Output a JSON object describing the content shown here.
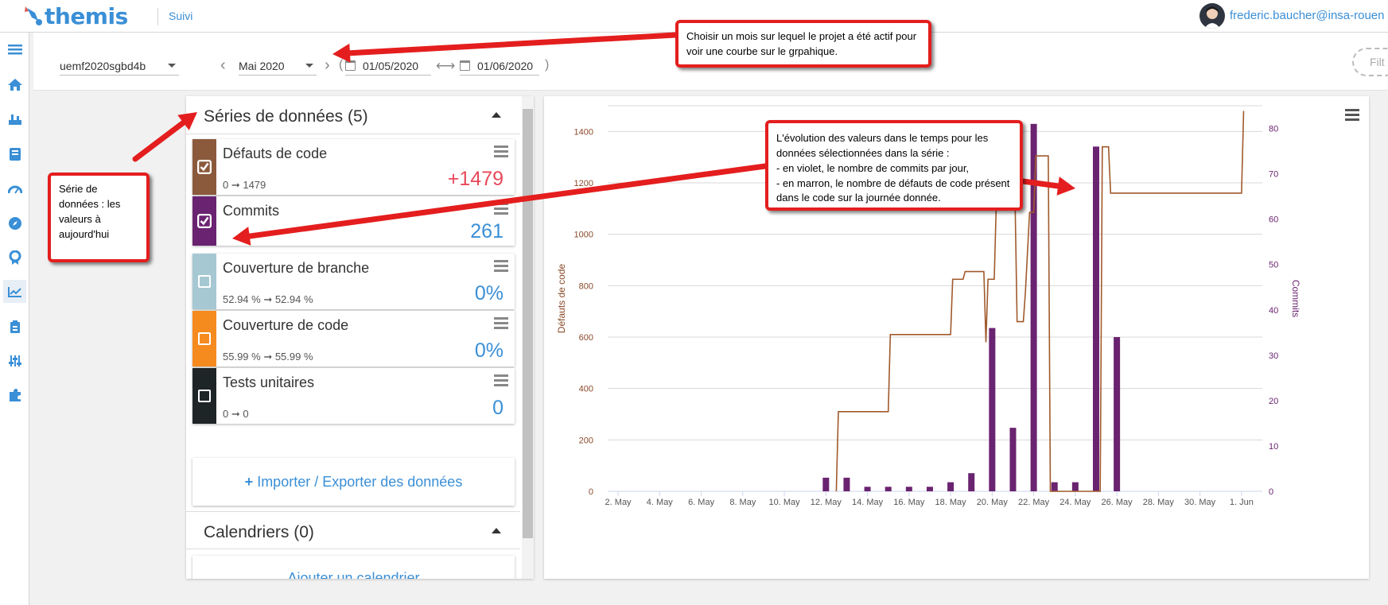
{
  "app": {
    "logo_text": "themis",
    "section": "Suivi",
    "user_email": "frederic.baucher@insa-rouen"
  },
  "sidebar": {
    "icons": [
      "menu-icon",
      "home-icon",
      "build-icon",
      "book-icon",
      "dashboard-icon",
      "compass-icon",
      "badge-icon",
      "chart-icon",
      "clipboard-icon",
      "settings-sliders-icon",
      "puzzle-icon"
    ]
  },
  "toolbar": {
    "project": "uemf2020sgbd4b",
    "month": "Mai 2020",
    "prev": "‹",
    "next": "›",
    "paren_open": "(",
    "paren_close": ")",
    "start_date": "01/05/2020",
    "range_arrow": "⟷",
    "end_date": "01/06/2020",
    "filter_placeholder": "Filt"
  },
  "series_panel": {
    "title": "Séries de données (5)",
    "items": [
      {
        "name": "Défauts de code",
        "range": "0 ➞ 1479",
        "value": "+1479",
        "color": "#8b5a3c",
        "checked": true,
        "value_color": "#e8485a"
      },
      {
        "name": "Commits",
        "range": "",
        "value": "261",
        "color": "#6a2370",
        "checked": true,
        "value_color": "#3a8fd6"
      },
      {
        "name": "Couverture de branche",
        "range": "52.94 % ➞ 52.94 %",
        "value": "0%",
        "color": "#a5c8d3",
        "checked": false,
        "value_color": "#3a8fd6"
      },
      {
        "name": "Couverture de code",
        "range": "55.99 % ➞ 55.99 %",
        "value": "0%",
        "color": "#f58a1f",
        "checked": false,
        "value_color": "#3a8fd6"
      },
      {
        "name": "Tests unitaires",
        "range": "0 ➞ 0",
        "value": "0",
        "color": "#1e2527",
        "checked": false,
        "value_color": "#3a8fd6"
      }
    ],
    "import_label": "Importer / Exporter des données",
    "calendars_title": "Calendriers (0)",
    "add_calendar_label": "Ajouter un calendrier"
  },
  "chart_data": {
    "type": "line",
    "x_tick_labels": [
      "2. May",
      "4. May",
      "6. May",
      "8. May",
      "10. May",
      "12. May",
      "14. May",
      "16. May",
      "18. May",
      "20. May",
      "22. May",
      "24. May",
      "26. May",
      "28. May",
      "30. May",
      "1. Jun"
    ],
    "ylabel_left": "Défauts de code",
    "ylabel_right": "Commits",
    "ylim_left": [
      0,
      1500
    ],
    "ylim_right": [
      0,
      85
    ],
    "yticks_left": [
      0,
      200,
      400,
      600,
      800,
      1000,
      1200,
      1400
    ],
    "yticks_right": [
      0,
      10,
      20,
      30,
      40,
      50,
      60,
      70,
      80
    ],
    "grid": true,
    "series": [
      {
        "name": "Défauts de code",
        "kind": "step-line",
        "axis": "left",
        "color": "#a05a2c",
        "points": [
          [
            12.5,
            0
          ],
          [
            12.6,
            310
          ],
          [
            15,
            310
          ],
          [
            15.1,
            610
          ],
          [
            18,
            610
          ],
          [
            18.1,
            825
          ],
          [
            18.6,
            825
          ],
          [
            18.7,
            855
          ],
          [
            19.6,
            855
          ],
          [
            19.7,
            580
          ],
          [
            19.8,
            825
          ],
          [
            20.1,
            825
          ],
          [
            20.2,
            1125
          ],
          [
            20.8,
            1125
          ],
          [
            20.9,
            1140
          ],
          [
            21.1,
            1140
          ],
          [
            21.2,
            660
          ],
          [
            21.5,
            660
          ],
          [
            21.6,
            775
          ],
          [
            21.8,
            1085
          ],
          [
            22,
            1085
          ],
          [
            22.1,
            1305
          ],
          [
            22.7,
            1305
          ],
          [
            22.8,
            0
          ],
          [
            25.2,
            0
          ],
          [
            25.3,
            1340
          ],
          [
            25.6,
            1340
          ],
          [
            25.7,
            1160
          ],
          [
            32,
            1160
          ],
          [
            32.1,
            1480
          ]
        ]
      },
      {
        "name": "Commits",
        "kind": "bar",
        "axis": "right",
        "color": "#6a2370",
        "points": [
          [
            12,
            3
          ],
          [
            13,
            3
          ],
          [
            14,
            1
          ],
          [
            15,
            1
          ],
          [
            16,
            1
          ],
          [
            17,
            1
          ],
          [
            18,
            2
          ],
          [
            19,
            4
          ],
          [
            20,
            36
          ],
          [
            21,
            14
          ],
          [
            22,
            81
          ],
          [
            23,
            2
          ],
          [
            24,
            2
          ],
          [
            25,
            76
          ],
          [
            26,
            34
          ]
        ]
      }
    ]
  },
  "annotations": [
    {
      "id": "month",
      "text": "Choisir un mois sur lequel le projet a été actif pour voir une courbe sur le grpahique."
    },
    {
      "id": "series",
      "text": "Série de données : les valeurs à aujourd'hui"
    },
    {
      "id": "evolution",
      "lines": [
        "L'évolution des valeurs dans le temps pour les données sélectionnées dans la série :",
        " - en violet, le nombre de commits par jour,",
        " - en marron, le nombre de défauts de code présent dans le code sur la journée donnée."
      ]
    }
  ]
}
